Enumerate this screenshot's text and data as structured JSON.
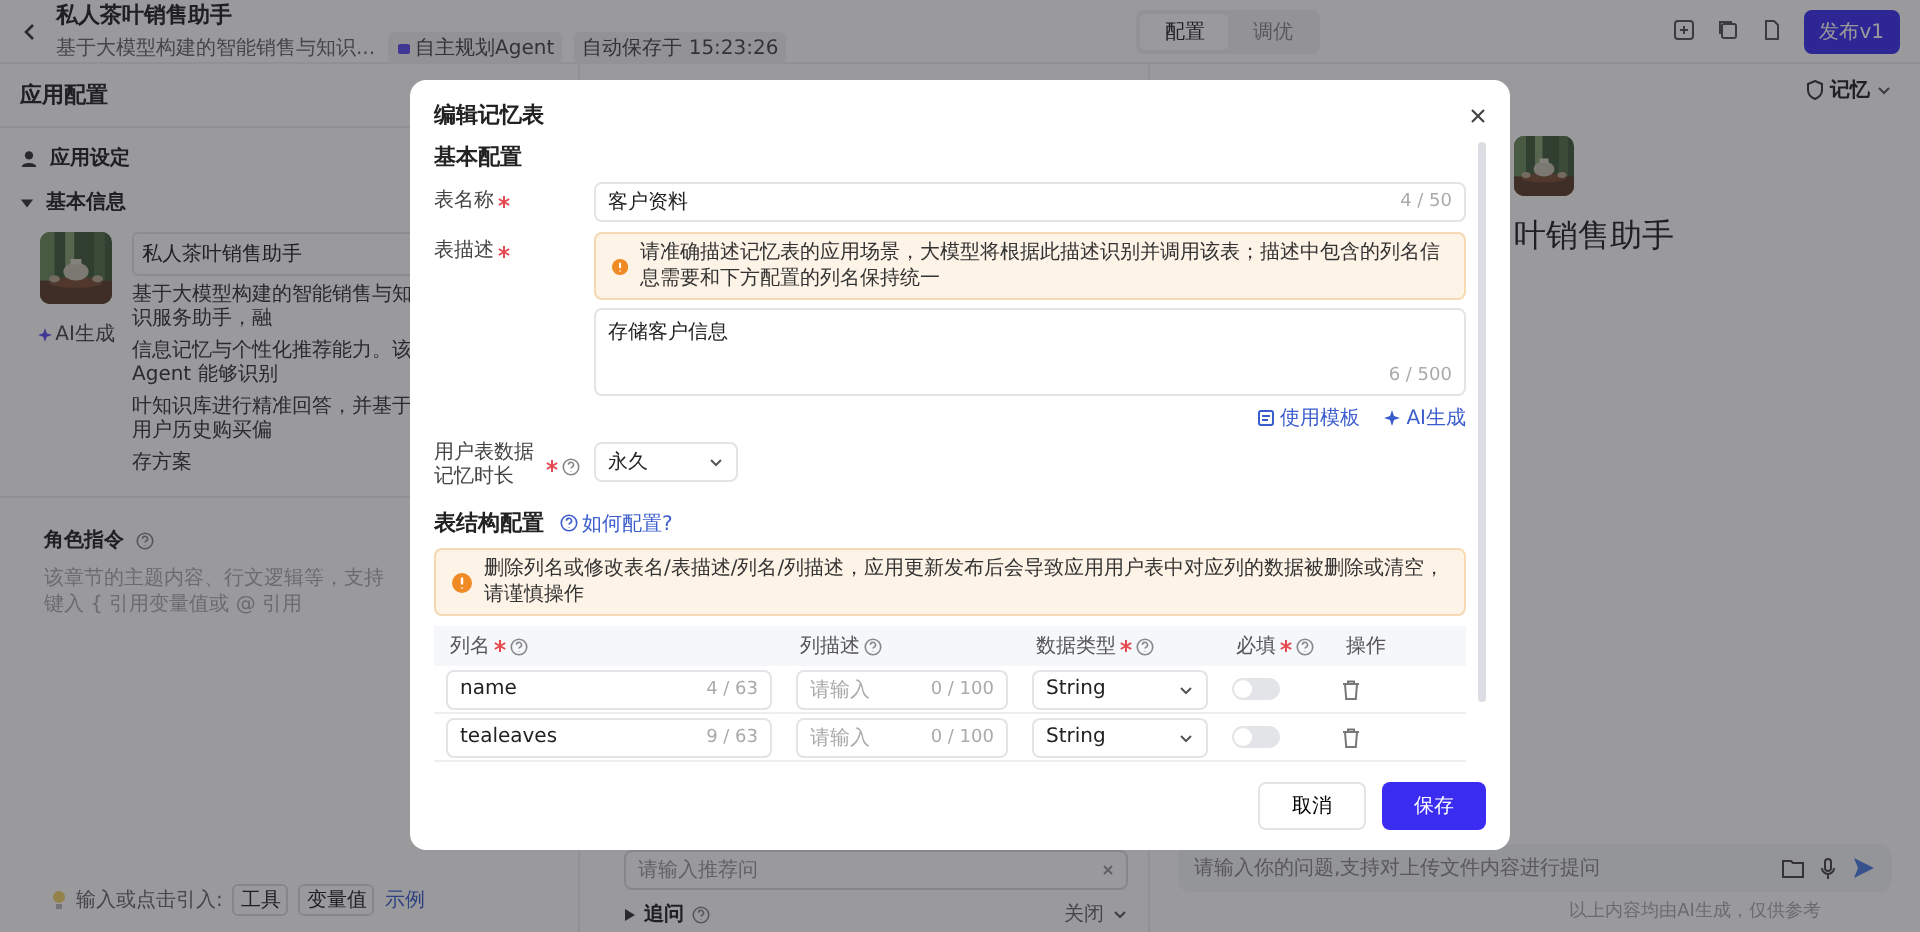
{
  "header": {
    "title": "私人茶叶销售助手",
    "subtitle": "基于大模型构建的智能销售与知识...",
    "agent_badge": "自主规划Agent",
    "autosave": "自动保存于 15:23:26",
    "tabs": [
      {
        "label": "配置",
        "selected": true
      },
      {
        "label": "调优",
        "selected": false
      }
    ],
    "publish_button": "发布v1"
  },
  "left_panel": {
    "title": "应用配置",
    "settings_label": "应用设定",
    "basic_info": {
      "label": "基本信息",
      "expanded": true
    },
    "ai_generate": "AI生成",
    "app_name": "私人茶叶销售助手",
    "description_lines": [
      "基于大模型构建的智能销售与知识服务助手，融",
      "信息记忆与个性化推荐能力。该 Agent 能够识别",
      "叶知识库进行精准回答，并基于用户历史购买偏",
      "存方案"
    ],
    "role_label": "角色指令",
    "role_placeholder": "该章节的主题内容、行文逻辑等，支持键入 { 引用变量值或 @ 引用",
    "hint": "输入或点击引入:",
    "chips": [
      "工具",
      "变量值"
    ],
    "example_link": "示例"
  },
  "middle": {
    "recommend_placeholder": "请输入推荐问",
    "follow_up": {
      "label": "追问",
      "status": "关闭"
    }
  },
  "right": {
    "memory_label": "记忆",
    "title": "叶销售助手",
    "chat_placeholder": "请输入你的问题,支持对上传文件内容进行提问",
    "disclaimer": "以上内容均由AI生成，仅供参考"
  },
  "modal": {
    "title": "编辑记忆表",
    "section": "基本配置",
    "name_field": {
      "label": "表名称",
      "required": true,
      "value": "客户资料",
      "count": "4 / 50"
    },
    "desc_field": {
      "label": "表描述",
      "required": true,
      "warning": "请准确描述记忆表的应用场景，大模型将根据此描述识别并调用该表；描述中包含的列名信息需要和下方配置的列名保持统一",
      "value": "存储客户信息",
      "count": "6 / 500"
    },
    "links": [
      {
        "kind": "template",
        "label": "使用模板"
      },
      {
        "kind": "ai",
        "label": "AI生成"
      }
    ],
    "duration_field": {
      "label": "用户表数据记忆时长",
      "required": true,
      "value": "永久"
    },
    "structure": {
      "title": "表结构配置",
      "help_link": "如何配置?",
      "warning": "删除列名或修改表名/表描述/列名/列描述，应用更新发布后会导致应用用户表中对应列的数据被删除或清空，请谨慎操作",
      "columns": [
        {
          "label": "列名",
          "required": true,
          "help": true
        },
        {
          "label": "列描述",
          "required": false,
          "help": true
        },
        {
          "label": "数据类型",
          "required": true,
          "help": true
        },
        {
          "label": "必填",
          "required": true,
          "help": true
        },
        {
          "label": "操作",
          "required": false,
          "help": false
        }
      ],
      "rows": [
        {
          "name": "name",
          "name_count": "4 / 63",
          "desc_placeholder": "请输入",
          "desc_count": "0 / 100",
          "type": "String",
          "required": false
        },
        {
          "name": "tealeaves",
          "name_count": "9 / 63",
          "desc_placeholder": "请输入",
          "desc_count": "0 / 100",
          "type": "String",
          "required": false
        }
      ]
    },
    "cancel_button": "取消",
    "save_button": "保存"
  }
}
